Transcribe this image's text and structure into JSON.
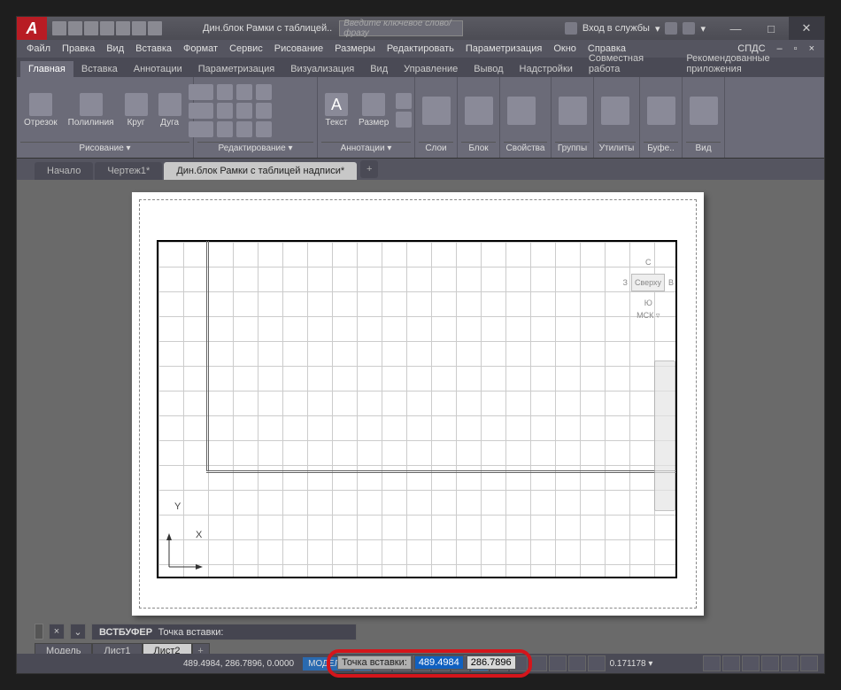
{
  "title": "Дин.блок Рамки с таблицей..",
  "search_placeholder": "Введите ключевое слово/фразу",
  "login": "Вход в службы",
  "menu": [
    "Файл",
    "Правка",
    "Вид",
    "Вставка",
    "Формат",
    "Сервис",
    "Рисование",
    "Размеры",
    "Редактировать",
    "Параметризация",
    "Окно",
    "Справка",
    "СПДС"
  ],
  "ribtabs": [
    "Главная",
    "Вставка",
    "Аннотации",
    "Параметризация",
    "Визуализация",
    "Вид",
    "Управление",
    "Вывод",
    "Надстройки",
    "Совместная работа",
    "Рекомендованные приложения"
  ],
  "panels": {
    "draw": {
      "lbl": "Рисование ▾",
      "tools": [
        "Отрезок",
        "Полилиния",
        "Круг",
        "Дуга"
      ]
    },
    "modify": {
      "lbl": "Редактирование ▾"
    },
    "annot": {
      "lbl": "Аннотации ▾",
      "tools": [
        "Текст",
        "Размер"
      ]
    },
    "layers": {
      "lbl": "Слои"
    },
    "block": {
      "lbl": "Блок"
    },
    "props": {
      "lbl": "Свойства"
    },
    "groups": {
      "lbl": "Группы"
    },
    "utils": {
      "lbl": "Утилиты"
    },
    "clip": {
      "lbl": "Буфе.."
    },
    "view": {
      "lbl": "Вид"
    }
  },
  "doctabs": [
    {
      "label": "Начало",
      "active": false
    },
    {
      "label": "Чертеж1*",
      "active": false
    },
    {
      "label": "Дин.блок Рамки с таблицей надписи*",
      "active": true
    }
  ],
  "viewcube": {
    "top": "С",
    "face": "Сверху",
    "s": "Ю",
    "e": "В",
    "w": "З",
    "wcs": "МСК ▿"
  },
  "dyninput": {
    "label": "Точка вставки:",
    "x": "489.4984",
    "y": "286.7896"
  },
  "cmd": {
    "prefix": "ВСТБУФЕР",
    "text": "Точка вставки:"
  },
  "layouts": [
    {
      "l": "Модель"
    },
    {
      "l": "Лист1"
    },
    {
      "l": "Лист2",
      "a": true
    }
  ],
  "status": {
    "coords": "489.4984, 286.7896, 0.0000",
    "mode": "МОДЕЛЬ",
    "angle": "0.171178 ▾"
  },
  "ucs": {
    "x": "X",
    "y": "Y"
  }
}
